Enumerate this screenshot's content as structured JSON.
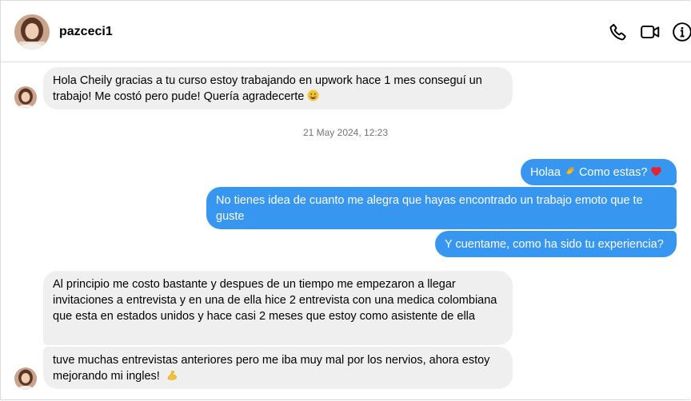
{
  "header": {
    "username": "pazceci1",
    "icons": [
      "phone-icon",
      "video-icon",
      "info-icon"
    ]
  },
  "conversation": {
    "timestamp": "21 May 2024, 12:23",
    "messages": [
      {
        "from": "them",
        "text": "Hola Cheily gracias a tu curso estoy trabajando en upwork hace 1 mes conseguí un trabajo! Me costó pero pude! Quería agradecerte",
        "emoji": "grinning-face-emoji"
      },
      {
        "from": "me",
        "text_a": "Holaa",
        "text_b": "Como estas?",
        "emoji_a": "waving-hand-emoji",
        "emoji_b": "red-heart-emoji"
      },
      {
        "from": "me",
        "text": "No tienes idea de cuanto me alegra que hayas encontrado un trabajo emoto que te guste"
      },
      {
        "from": "me",
        "text": "Y cuentame, como ha sido tu experiencia?"
      },
      {
        "from": "them",
        "text": "Al principio me costo bastante y despues de un tiempo me empezaron a llegar invitaciones a entrevista y en una de ella hice 2 entrevista con una medica colombiana que esta en estados unidos y hace casi 2 meses que estoy como asistente de ella"
      },
      {
        "from": "them",
        "text": "tuve muchas entrevistas anteriores pero me iba muy mal por los nervios, ahora estoy mejorando mi ingles!",
        "emoji": "flexed-biceps-emoji"
      }
    ]
  },
  "colors": {
    "outgoing_bubble": "#3797f0",
    "incoming_bubble": "#efefef",
    "border": "#dbdbdb",
    "timestamp_text": "#737373"
  }
}
